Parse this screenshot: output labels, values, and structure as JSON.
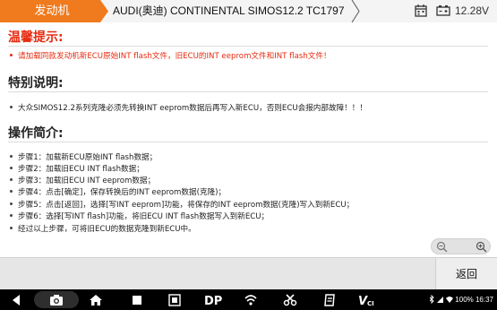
{
  "header": {
    "active_tab": "发动机",
    "path": "AUDI(奥迪) CONTINENTAL SIMOS12.2 TC1797",
    "voltage": "12.28V",
    "accent_color": "#f07a1e"
  },
  "sections": {
    "warning": {
      "title": "温馨提示:",
      "lines": [
        "请加载同款发动机新ECU原始INT flash文件，旧ECU的INT eeprom文件和INT flash文件！"
      ]
    },
    "special": {
      "title": "特别说明:",
      "lines": [
        "大众SIMOS12.2系列克隆必须先转换INT eeprom数据后再写入新ECU，否则ECU会报内部故障！！！"
      ]
    },
    "steps": {
      "title": "操作简介:",
      "lines": [
        "步骤1：加载新ECU原始INT flash数据；",
        "步骤2：加载旧ECU INT flash数据；",
        "步骤3：加载旧ECU INT eeprom数据；",
        "步骤4：点击[确定]，保存转换后的INT eeprom数据(克隆)；",
        "步骤5：点击[返回]，选择[写INT eeprom]功能，将保存的INT eeprom数据(克隆)写入到新ECU；",
        "步骤6：选择[写INT flash]功能，将旧ECU INT flash数据写入到新ECU；",
        "经过以上步骤，可将旧ECU的数据克隆到新ECU中。"
      ]
    }
  },
  "footer": {
    "back_label": "返回"
  },
  "statusbar": {
    "text": "100% 16:37"
  }
}
